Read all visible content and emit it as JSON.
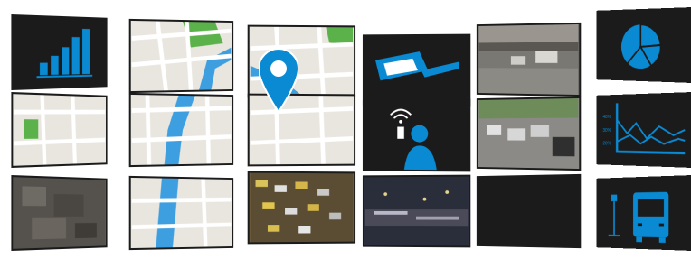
{
  "wall": {
    "accent_color": "#0a8ad2",
    "tile_bg": "#1b1b1b",
    "map_colors": {
      "road": "#ffffff",
      "block": "#e9e6df",
      "water": "#3e9fe0",
      "park": "#5bb24a"
    }
  },
  "tiles": {
    "r1c1": {
      "icon": "bar-chart-icon"
    },
    "r1c2": {
      "icon": "map-icon"
    },
    "r1c3": {
      "icon": "map-icon"
    },
    "r1c4": {
      "icon": "camera-icon"
    },
    "r1c5": {
      "icon": "traffic-photo"
    },
    "r1c6": {
      "icon": "pie-chart-icon"
    },
    "r2c1": {
      "icon": "map-icon"
    },
    "r2c2": {
      "icon": "map-icon"
    },
    "r2c3": {
      "icon": "map-pin-icon"
    },
    "r2c4": {
      "icon": "person-phone-icon"
    },
    "r2c5": {
      "icon": "traffic-photo"
    },
    "r2c6": {
      "icon": "line-chart-icon",
      "y_ticks": [
        "40%",
        "30%",
        "20%"
      ]
    },
    "r3c1": {
      "icon": "aerial-photo"
    },
    "r3c2": {
      "icon": "map-icon"
    },
    "r3c3": {
      "icon": "traffic-photo"
    },
    "r3c4": {
      "icon": "city-night-photo"
    },
    "r3c5": {
      "icon": "blank-screen"
    },
    "r3c6": {
      "icon": "bus-stop-icon"
    }
  }
}
